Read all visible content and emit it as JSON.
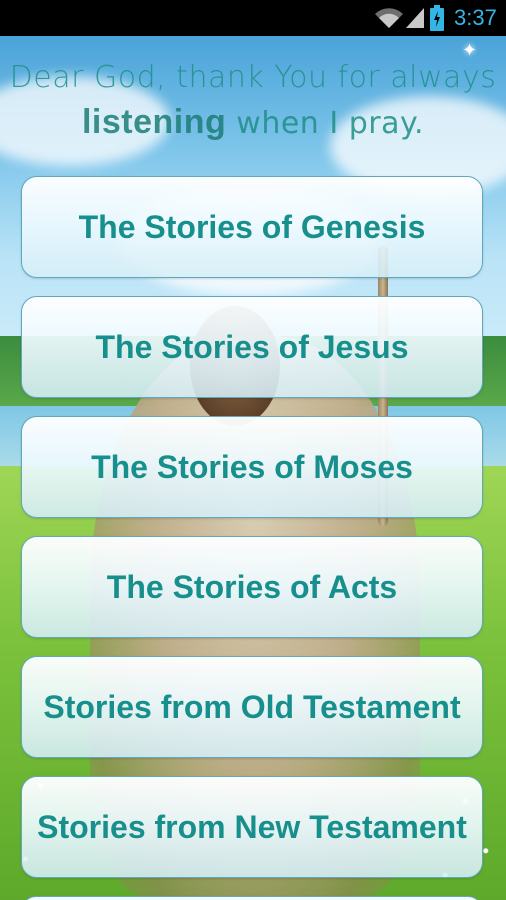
{
  "status_bar": {
    "time": "3:37",
    "icons": [
      "wifi-icon",
      "cell-signal-icon",
      "battery-charging-icon"
    ],
    "clock_color": "#33b5e5"
  },
  "header": {
    "verse_line1": "Dear God, thank You for always",
    "verse_emphasis": "listening",
    "verse_line2_rest": " when I pray."
  },
  "menu": {
    "items": [
      {
        "label": "The Stories of Genesis"
      },
      {
        "label": "The Stories of Jesus"
      },
      {
        "label": "The Stories of Moses"
      },
      {
        "label": "The Stories of Acts"
      },
      {
        "label": "Stories from Old Testament"
      },
      {
        "label": "Stories from New Testament"
      }
    ]
  },
  "colors": {
    "button_text": "#178f8c",
    "verse_text": "#1e8f86",
    "button_border": "#5fa9bf"
  }
}
